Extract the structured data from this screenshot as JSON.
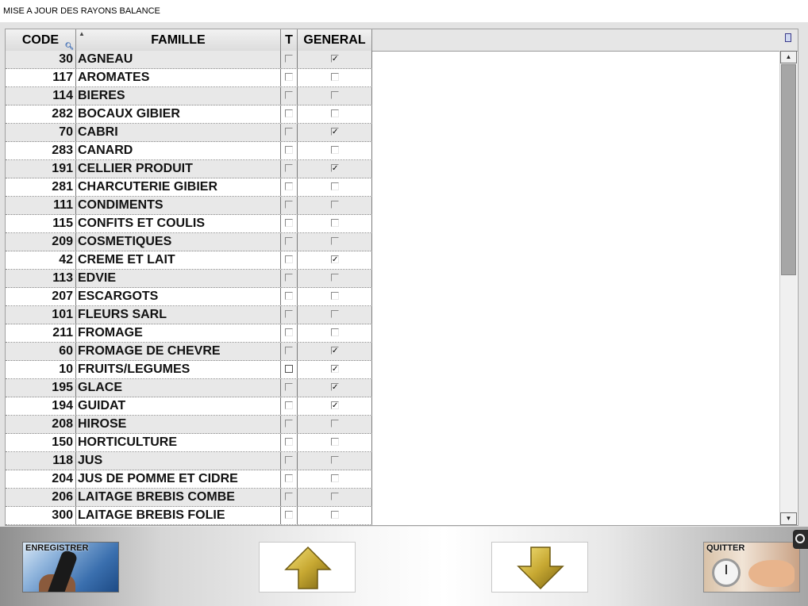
{
  "window": {
    "title": "MISE A JOUR DES RAYONS BALANCE"
  },
  "grid": {
    "columns": {
      "code": "CODE",
      "famille": "FAMILLE",
      "t": "T",
      "general": "GENERAL"
    },
    "rows": [
      {
        "code": "30",
        "famille": "AGNEAU",
        "t": false,
        "general": true
      },
      {
        "code": "117",
        "famille": "AROMATES",
        "t": false,
        "general": false
      },
      {
        "code": "114",
        "famille": "BIERES",
        "t": false,
        "general": false
      },
      {
        "code": "282",
        "famille": "BOCAUX GIBIER",
        "t": false,
        "general": false
      },
      {
        "code": "70",
        "famille": "CABRI",
        "t": false,
        "general": true
      },
      {
        "code": "283",
        "famille": "CANARD",
        "t": false,
        "general": false
      },
      {
        "code": "191",
        "famille": "CELLIER PRODUIT",
        "t": false,
        "general": true
      },
      {
        "code": "281",
        "famille": "CHARCUTERIE GIBIER",
        "t": false,
        "general": false
      },
      {
        "code": "111",
        "famille": "CONDIMENTS",
        "t": false,
        "general": false
      },
      {
        "code": "115",
        "famille": "CONFITS ET COULIS",
        "t": false,
        "general": false
      },
      {
        "code": "209",
        "famille": "COSMETIQUES",
        "t": false,
        "general": false
      },
      {
        "code": "42",
        "famille": "CREME ET LAIT",
        "t": false,
        "general": true
      },
      {
        "code": "113",
        "famille": "EDVIE",
        "t": false,
        "general": false
      },
      {
        "code": "207",
        "famille": "ESCARGOTS",
        "t": false,
        "general": false
      },
      {
        "code": "101",
        "famille": "FLEURS SARL",
        "t": false,
        "general": false
      },
      {
        "code": "211",
        "famille": "FROMAGE",
        "t": false,
        "general": false
      },
      {
        "code": "60",
        "famille": "FROMAGE DE CHEVRE",
        "t": false,
        "general": true
      },
      {
        "code": "10",
        "famille": "FRUITS/LEGUMES",
        "t": false,
        "general": true,
        "t_focus": true
      },
      {
        "code": "195",
        "famille": "GLACE",
        "t": false,
        "general": true
      },
      {
        "code": "194",
        "famille": "GUIDAT",
        "t": false,
        "general": true
      },
      {
        "code": "208",
        "famille": "HIROSE",
        "t": false,
        "general": false
      },
      {
        "code": "150",
        "famille": "HORTICULTURE",
        "t": false,
        "general": false
      },
      {
        "code": "118",
        "famille": "JUS",
        "t": false,
        "general": false
      },
      {
        "code": "204",
        "famille": "JUS DE POMME ET CIDRE",
        "t": false,
        "general": false
      },
      {
        "code": "206",
        "famille": "LAITAGE BREBIS COMBE",
        "t": false,
        "general": false
      },
      {
        "code": "300",
        "famille": "LAITAGE BREBIS FOLIE",
        "t": false,
        "general": false
      }
    ]
  },
  "buttons": {
    "save": "ENREGISTRER",
    "quit": "QUITTER"
  },
  "icons": {
    "search": "magnifier-icon",
    "sort": "sort-ascending-icon",
    "columns": "column-selector-icon",
    "up": "arrow-up-icon",
    "down": "arrow-down-icon"
  },
  "colors": {
    "row_alt": "#e8e8e8",
    "arrow_gold": "#b8a030",
    "scroll_thumb": "#a6a6a6"
  }
}
